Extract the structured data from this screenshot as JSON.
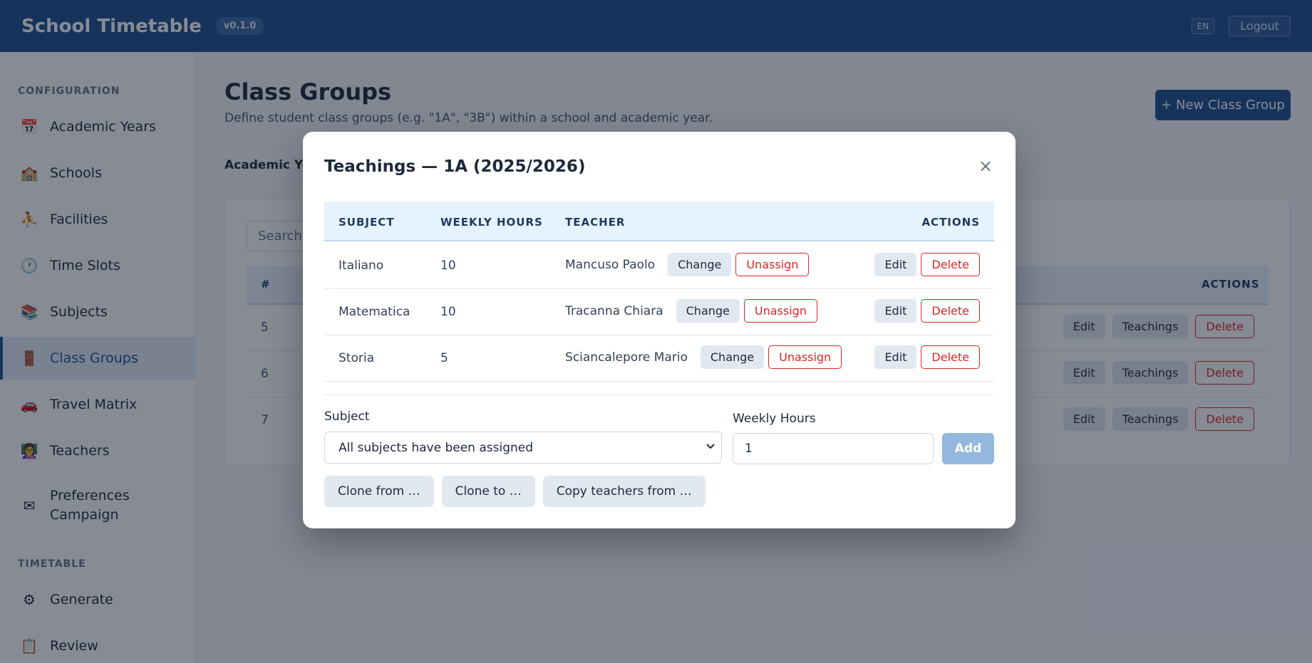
{
  "header": {
    "title": "School Timetable",
    "version": "v0.1.0",
    "lang": "EN",
    "logout": "Logout"
  },
  "sidebar": {
    "sections": [
      {
        "label": "CONFIGURATION"
      },
      {
        "label": "TIMETABLE"
      }
    ],
    "items": [
      {
        "label": "Academic Years",
        "icon": "📅"
      },
      {
        "label": "Schools",
        "icon": "🏫"
      },
      {
        "label": "Facilities",
        "icon": "⛹"
      },
      {
        "label": "Time Slots",
        "icon": "🕐"
      },
      {
        "label": "Subjects",
        "icon": "📚"
      },
      {
        "label": "Class Groups",
        "icon": "🚪"
      },
      {
        "label": "Travel Matrix",
        "icon": "🚗"
      },
      {
        "label": "Teachers",
        "icon": "👩‍🏫"
      },
      {
        "label": "Preferences Campaign",
        "icon": "✉"
      },
      {
        "label": "Generate",
        "icon": "⚙"
      },
      {
        "label": "Review",
        "icon": "📋"
      }
    ]
  },
  "main": {
    "title": "Class Groups",
    "description": "Define student class groups (e.g. \"1A\", \"3B\") within a school and academic year.",
    "new_button": "+ New Class Group",
    "filter_label": "Academic Yea",
    "search_placeholder": "Search c",
    "table": {
      "hash": "#",
      "actions": "ACTIONS",
      "rows": [
        {
          "num": "5"
        },
        {
          "num": "6"
        },
        {
          "num": "7"
        }
      ],
      "edit": "Edit",
      "teachings": "Teachings",
      "delete": "Delete"
    }
  },
  "modal": {
    "title": "Teachings — 1A (2025/2026)",
    "close": "×",
    "columns": {
      "subject": "SUBJECT",
      "hours": "WEEKLY HOURS",
      "teacher": "TEACHER",
      "actions": "ACTIONS"
    },
    "rows": [
      {
        "subject": "Italiano",
        "hours": "10",
        "teacher": "Mancuso Paolo"
      },
      {
        "subject": "Matematica",
        "hours": "10",
        "teacher": "Tracanna Chiara"
      },
      {
        "subject": "Storia",
        "hours": "5",
        "teacher": "Sciancalepore Mario"
      }
    ],
    "change": "Change",
    "unassign": "Unassign",
    "edit": "Edit",
    "delete": "Delete",
    "form": {
      "subject_label": "Subject",
      "subject_value": "All subjects have been assigned",
      "hours_label": "Weekly Hours",
      "hours_value": "1",
      "add": "Add"
    },
    "clone_from": "Clone from …",
    "clone_to": "Clone to …",
    "copy_teachers": "Copy teachers from …"
  }
}
